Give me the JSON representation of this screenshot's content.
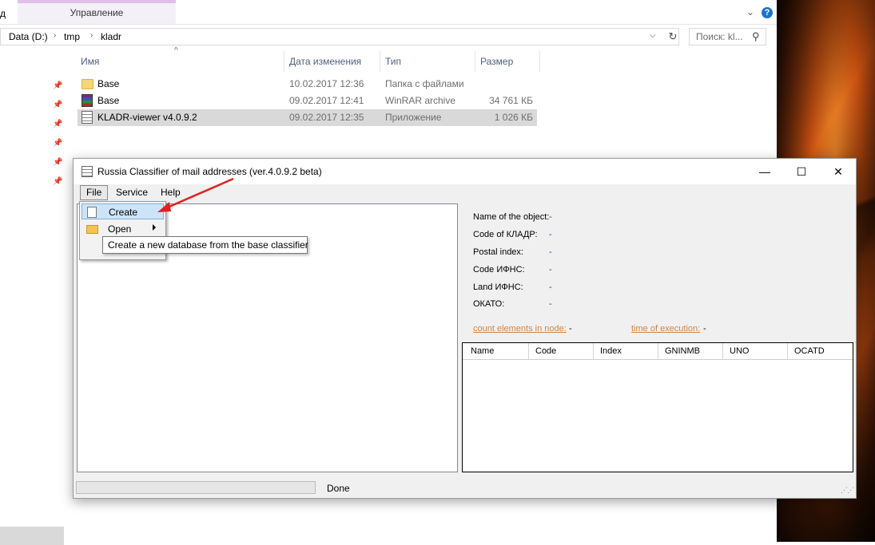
{
  "explorer": {
    "ribbon": {
      "left_text": "д",
      "tab_label": "Управление"
    },
    "address": {
      "crumbs": [
        "Data (D:)",
        "tmp",
        "kladr"
      ],
      "separator": "›"
    },
    "search": {
      "placeholder": "Поиск: kl..."
    },
    "columns": {
      "name": "Имя",
      "date": "Дата изменения",
      "type": "Тип",
      "size": "Размер"
    },
    "files": [
      {
        "name": "Base",
        "date": "10.02.2017 12:36",
        "type": "Папка с файлами",
        "size": "",
        "icon": "folder-icon"
      },
      {
        "name": "Base",
        "date": "09.02.2017 12:41",
        "type": "WinRAR archive",
        "size": "34 761 КБ",
        "icon": "winrar-icon"
      },
      {
        "name": "KLADR-viewer v4.0.9.2",
        "date": "09.02.2017 12:35",
        "type": "Приложение",
        "size": "1 026 КБ",
        "icon": "application-icon",
        "selected": true
      }
    ]
  },
  "app": {
    "title": "Russia Classifier of mail addresses",
    "version": "(ver.4.0.9.2 beta)",
    "menu": [
      "File",
      "Service",
      "Help"
    ],
    "file_menu": {
      "items": [
        "Create",
        "Open"
      ],
      "hovered": "Create",
      "tooltip": "Create a new database from the base classifier"
    },
    "info": {
      "fields": [
        {
          "label": "Name of the object:",
          "value": "-"
        },
        {
          "label": "Code of КЛАДР:",
          "value": "-"
        },
        {
          "label": "Postal index:",
          "value": "-"
        },
        {
          "label": "Code ИФНС:",
          "value": "-"
        },
        {
          "label": "Land ИФНС:",
          "value": "-"
        },
        {
          "label": "ОКАТО:",
          "value": "-"
        }
      ],
      "count_label": "count elements in node:",
      "count_value": "-",
      "time_label": "time of execution:",
      "time_value": "-"
    },
    "grid_columns": [
      "Name",
      "Code",
      "Index",
      "GNINMB",
      "UNO",
      "OCATD"
    ],
    "status": {
      "text": "Done",
      "progress": 0
    }
  },
  "colors": {
    "accent": "#cce4f7",
    "link": "#d08440",
    "value": "#1a3fa8",
    "arrow": "#e02020"
  }
}
